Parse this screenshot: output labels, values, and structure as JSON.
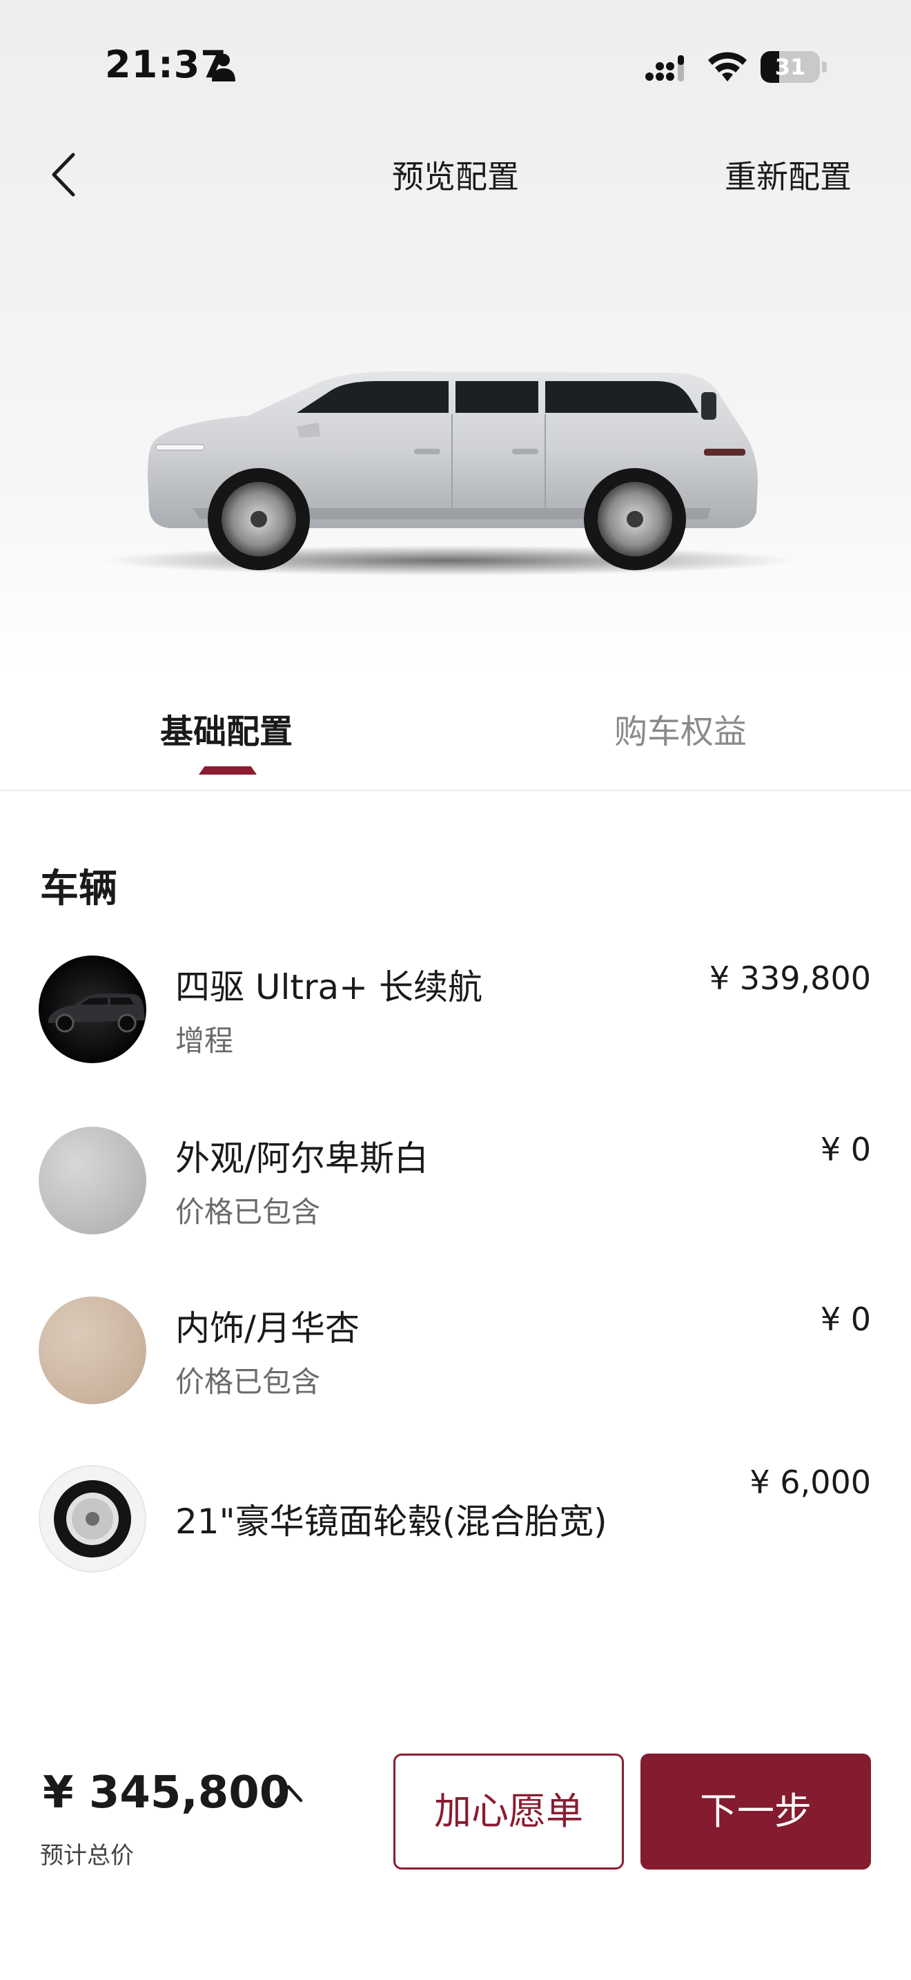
{
  "status_bar": {
    "time": "21:37",
    "battery_level": "31",
    "battery_fraction": 0.31
  },
  "nav": {
    "title": "预览配置",
    "reconfigure_label": "重新配置"
  },
  "tabs": [
    {
      "label": "基础配置",
      "active": true
    },
    {
      "label": "购车权益",
      "active": false
    }
  ],
  "section": {
    "title": "车辆"
  },
  "items": [
    {
      "name": "四驱 Ultra+ 长续航",
      "sub": "增程",
      "price": "¥ 339,800",
      "thumb": "vehicle"
    },
    {
      "name": "外观/阿尔卑斯白",
      "sub": "价格已包含",
      "price": "¥ 0",
      "thumb": "exterior-color"
    },
    {
      "name": "内饰/月华杏",
      "sub": "价格已包含",
      "price": "¥ 0",
      "thumb": "interior-color"
    },
    {
      "name": "21\"豪华镜面轮毂(混合胎宽)",
      "sub": "",
      "price": "¥ 6,000",
      "thumb": "wheel"
    }
  ],
  "summary": {
    "total_price": "¥ 345,800",
    "total_label": "预计总价"
  },
  "actions": {
    "wishlist_label": "加心愿单",
    "next_label": "下一步"
  },
  "colors": {
    "accent": "#841b2f",
    "exterior_swatch": "#bdbdbd",
    "interior_swatch": "#cdb7a3"
  },
  "icons": [
    "person-icon",
    "signal-icon",
    "wifi-icon",
    "battery-icon",
    "back-chevron-icon",
    "chevron-up-icon"
  ]
}
